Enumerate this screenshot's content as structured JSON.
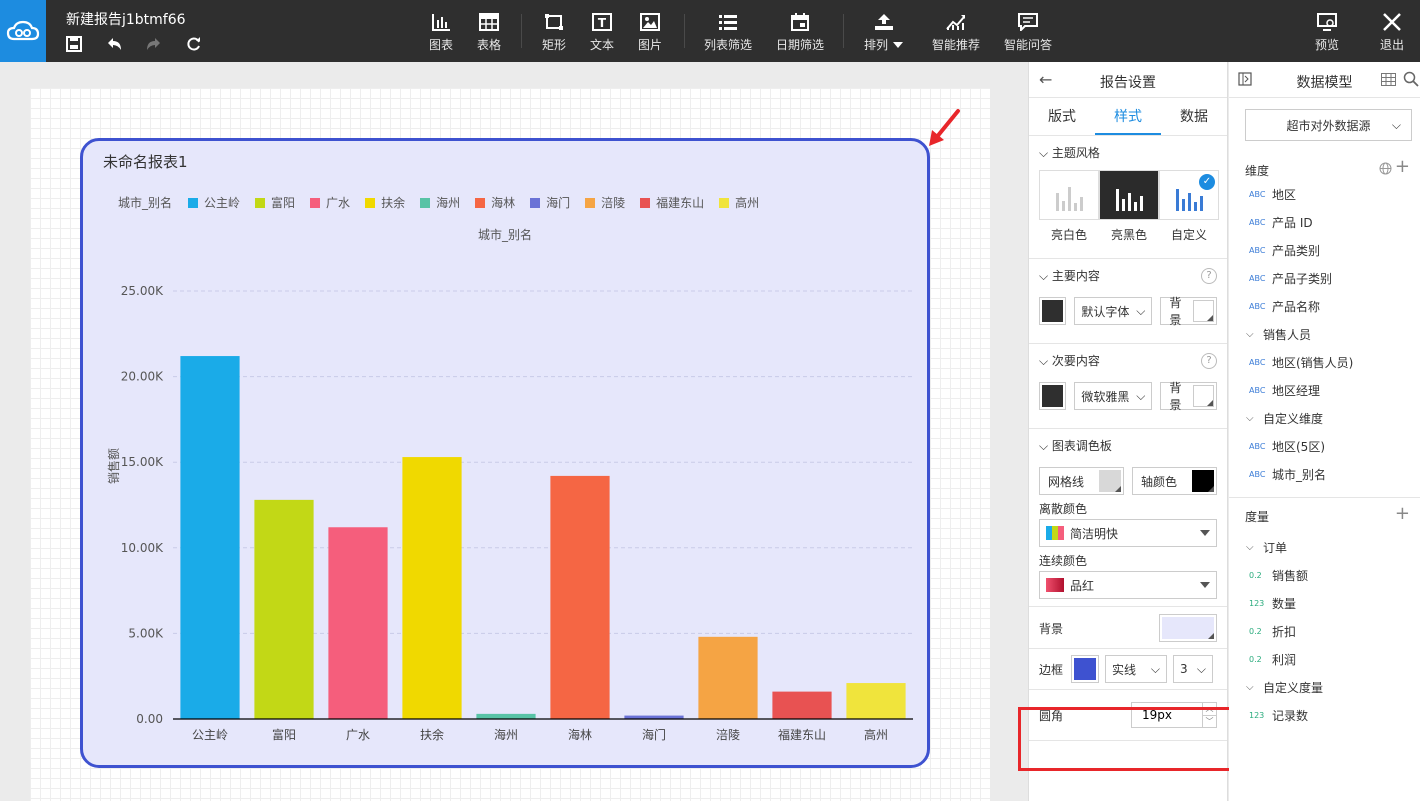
{
  "colors": {
    "accent": "#1d8ce0",
    "card_bg": "#e6e7fb",
    "card_border": "#3e52d0",
    "highlight": "#e8262a"
  },
  "topbar": {
    "title": "新建报告j1btmf66",
    "tools": [
      {
        "label": "图表",
        "icon": "bar-chart-icon"
      },
      {
        "label": "表格",
        "icon": "table-icon"
      },
      {
        "label": "矩形",
        "icon": "rectangle-icon"
      },
      {
        "label": "文本",
        "icon": "text-icon"
      },
      {
        "label": "图片",
        "icon": "image-icon"
      },
      {
        "label": "列表筛选",
        "icon": "list-filter-icon"
      },
      {
        "label": "日期筛选",
        "icon": "calendar-icon"
      },
      {
        "label": "排列",
        "icon": "arrange-icon"
      },
      {
        "label": "智能推荐",
        "icon": "smart-recommend-icon"
      },
      {
        "label": "智能问答",
        "icon": "chat-icon"
      }
    ],
    "preview": "预览",
    "exit": "退出"
  },
  "report": {
    "title": "未命名报表1",
    "legend_title": "城市_别名",
    "x_title": "城市_别名",
    "y_title": "销售额"
  },
  "chart_data": {
    "type": "bar",
    "categories": [
      "公主岭",
      "富阳",
      "广水",
      "扶余",
      "海州",
      "海林",
      "海门",
      "涪陵",
      "福建东山",
      "高州"
    ],
    "values": [
      21200,
      12800,
      11200,
      15300,
      300,
      14200,
      200,
      4800,
      1600,
      2100
    ],
    "colors": [
      "#1aabe8",
      "#c2d816",
      "#f55e7c",
      "#f0d900",
      "#58c3a6",
      "#f56644",
      "#6a72d6",
      "#f5a444",
      "#e85252",
      "#f0e43c"
    ],
    "y_ticks": [
      "0.00",
      "5.00K",
      "10.00K",
      "15.00K",
      "20.00K",
      "25.00K"
    ],
    "ylim": [
      0,
      25000
    ],
    "ylabel": "销售额",
    "xlabel": "城市_别名",
    "legend": "top-left",
    "grid": true
  },
  "settings": {
    "title": "报告设置",
    "tabs": [
      "版式",
      "样式",
      "数据"
    ],
    "theme": {
      "title": "主题风格",
      "options": [
        "亮白色",
        "亮黑色",
        "自定义"
      ]
    },
    "primary": {
      "title": "主要内容",
      "font": "默认字体",
      "bg": "背景"
    },
    "secondary": {
      "title": "次要内容",
      "font": "微软雅黑",
      "bg": "背景"
    },
    "palette": {
      "title": "图表调色板",
      "grid": "网格线",
      "axis": "轴颜色",
      "discrete_label": "离散颜色",
      "discrete_value": "简洁明快",
      "continuous_label": "连续颜色",
      "continuous_value": "品红"
    },
    "background": "背景",
    "border": {
      "label": "边框",
      "style": "实线",
      "width": "3"
    },
    "radius": {
      "label": "圆角",
      "value": "19px"
    }
  },
  "model": {
    "title": "数据模型",
    "source": "超市对外数据源",
    "dimension": "维度",
    "dims": [
      {
        "type": "ABC",
        "name": "地区"
      },
      {
        "type": "ABC",
        "name": "产品 ID"
      },
      {
        "type": "ABC",
        "name": "产品类别"
      },
      {
        "type": "ABC",
        "name": "产品子类别"
      },
      {
        "type": "ABC",
        "name": "产品名称"
      },
      {
        "type": "folder",
        "name": "销售人员"
      },
      {
        "type": "ABC",
        "name": "地区(销售人员)"
      },
      {
        "type": "ABC",
        "name": "地区经理"
      },
      {
        "type": "folder",
        "name": "自定义维度"
      },
      {
        "type": "ABC",
        "name": "地区(5区)"
      },
      {
        "type": "ABC",
        "name": "城市_别名"
      }
    ],
    "measure": "度量",
    "measures": [
      {
        "type": "folder",
        "name": "订单"
      },
      {
        "type": "0.2",
        "name": "销售额"
      },
      {
        "type": "123",
        "name": "数量"
      },
      {
        "type": "0.2",
        "name": "折扣"
      },
      {
        "type": "0.2",
        "name": "利润"
      },
      {
        "type": "folder",
        "name": "自定义度量"
      },
      {
        "type": "123",
        "name": "记录数"
      }
    ]
  }
}
